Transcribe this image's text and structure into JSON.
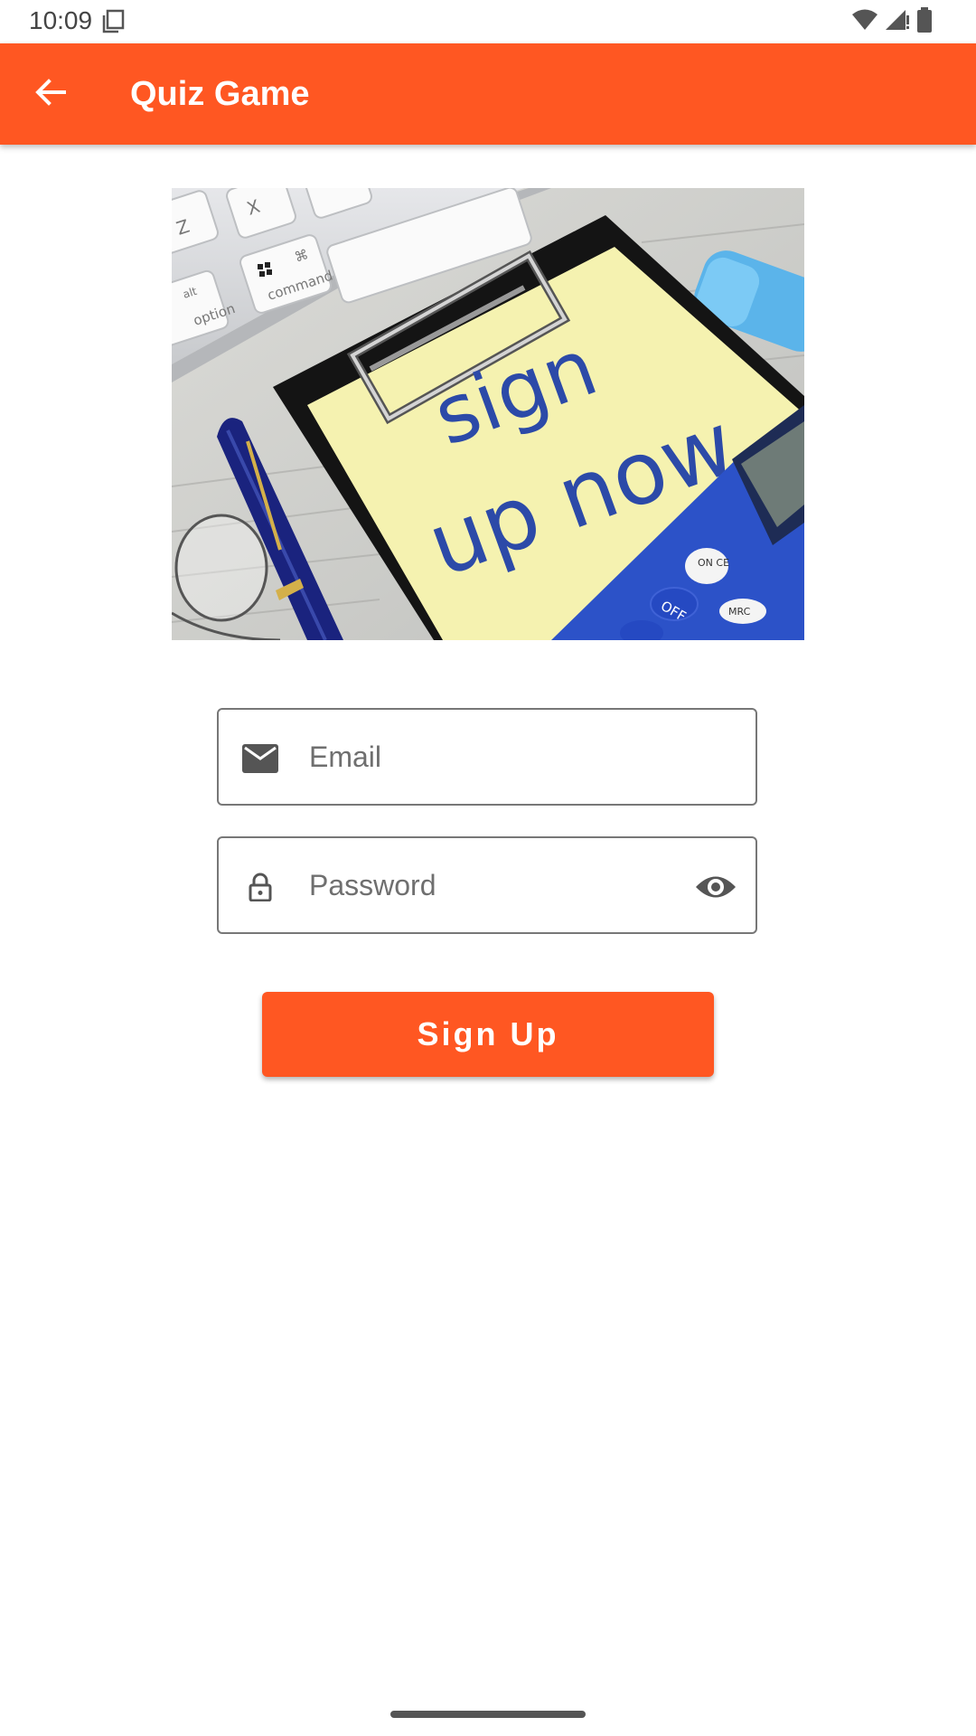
{
  "status_bar": {
    "time": "10:09"
  },
  "app_bar": {
    "title": "Quiz Game",
    "background_color": "#FF5722"
  },
  "hero_image": {
    "line1": "sign",
    "line2": "up now",
    "keyboard_keys": [
      "Z",
      "X",
      "alt",
      "option",
      "command",
      "⌘"
    ],
    "calculator_keys": [
      "ON CE",
      "OFF",
      "MRC"
    ]
  },
  "form": {
    "email": {
      "placeholder": "Email",
      "value": ""
    },
    "password": {
      "placeholder": "Password",
      "value": ""
    }
  },
  "signup_button": {
    "label": "Sign Up",
    "color": "#FF5722"
  },
  "icons": {
    "back": "arrow-back-icon",
    "email": "mail-icon",
    "password": "lock-icon",
    "visibility": "eye-icon"
  }
}
